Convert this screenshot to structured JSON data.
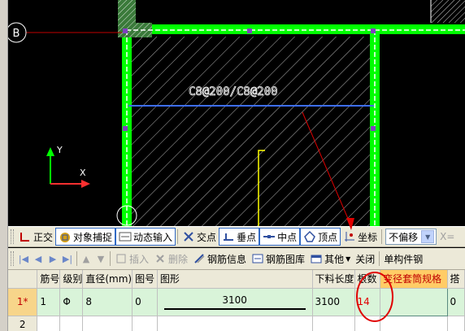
{
  "cad": {
    "axis_label": "B",
    "rebar_label": "C8@200/C8@200",
    "ucs_y": "Y",
    "ucs_x": "X"
  },
  "snap_toolbar": {
    "items": [
      {
        "label": "正交",
        "icon": "ortho-icon"
      },
      {
        "label": "对象捕捉",
        "icon": "object-snap-icon"
      },
      {
        "label": "动态输入",
        "icon": "dynamic-input-icon"
      },
      {
        "label": "交点",
        "icon": "intersection-icon"
      },
      {
        "label": "垂点",
        "icon": "perpendicular-icon"
      },
      {
        "label": "中点",
        "icon": "midpoint-icon"
      },
      {
        "label": "顶点",
        "icon": "vertex-icon"
      },
      {
        "label": "坐标",
        "icon": "coordinate-icon"
      }
    ],
    "offset_select": "不偏移",
    "x_label": "X="
  },
  "nav_toolbar": {
    "insert": "插入",
    "delete": "删除",
    "rebar_info": "钢筋信息",
    "rebar_library": "钢筋图库",
    "other": "其他",
    "close": "关闭",
    "single_member": "单构件钢"
  },
  "grid": {
    "headers": [
      "筋号",
      "级别",
      "直径(mm)",
      "图号",
      "图形",
      "下料长度",
      "根数",
      "变径套筒规格",
      "搭"
    ],
    "rows": [
      {
        "row_no": "1*",
        "bar_no": "1",
        "grade": "Φ",
        "diameter": "8",
        "figure_no": "0",
        "shape_length": "3100",
        "cut_length": "3100",
        "count": "14",
        "sleeve": "",
        "lap": "0"
      },
      {
        "row_no": "2",
        "bar_no": "",
        "grade": "",
        "diameter": "",
        "figure_no": "",
        "shape_length": "",
        "cut_length": "",
        "count": "",
        "sleeve": "",
        "lap": ""
      }
    ]
  },
  "colors": {
    "wall_green": "#00ff00",
    "rebar_blue": "#3d6eff",
    "annotation_red": "#e00000",
    "selected_row": "#d9f4d9"
  }
}
